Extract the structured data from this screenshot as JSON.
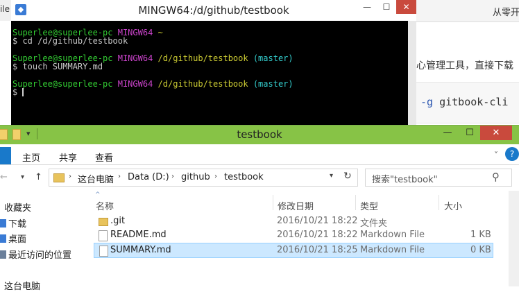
{
  "background_page": {
    "title": "从零开",
    "text_line": "心管理工具，直接下载",
    "code_prefix": "-g",
    "code_rest": " gitbook-cli"
  },
  "left_window": {
    "title": "ile"
  },
  "terminal": {
    "title": "MINGW64:/d/github/testbook",
    "controls": {
      "minimize": "—",
      "maximize": "☐",
      "close": "✕"
    },
    "icon": "mingw-terminal-icon",
    "user": "Superlee@superlee-pc",
    "env": "MINGW64",
    "lines": {
      "l1_path": "~",
      "l2": "$ cd /d/github/testbook",
      "l3_path": "/d/github/testbook",
      "l3_branch": "(master)",
      "l4": "$ touch SUMMARY.md",
      "l5_path": "/d/github/testbook",
      "l5_branch": "(master)",
      "l6": "$"
    },
    "colors": {
      "user": "#33cc33",
      "env": "#cc44cc",
      "path": "#cccc33",
      "branch": "#33cccc"
    }
  },
  "explorer": {
    "title": "testbook",
    "controls": {
      "minimize": "—",
      "maximize": "☐",
      "close": "✕"
    },
    "ribbon_tabs": [
      "主页",
      "共享",
      "查看"
    ],
    "nav": {
      "back": "←",
      "forward_dropdown": "▾",
      "up": "↑"
    },
    "breadcrumb": [
      "这台电脑",
      "Data (D:)",
      "github",
      "testbook"
    ],
    "search_placeholder": "搜索\"testbook\"",
    "columns": {
      "name": "名称",
      "modified": "修改日期",
      "type": "类型",
      "size": "大小"
    },
    "nav_pane": [
      "收藏夹",
      "下载",
      "桌面",
      "最近访问的位置",
      "这台电脑"
    ],
    "files": [
      {
        "name": ".git",
        "modified": "2016/10/21 18:22",
        "type": "文件夹",
        "size": "",
        "icon": "folder-icon"
      },
      {
        "name": "README.md",
        "modified": "2016/10/21 18:22",
        "type": "Markdown File",
        "size": "1 KB",
        "icon": "markdown-file-icon"
      },
      {
        "name": "SUMMARY.md",
        "modified": "2016/10/21 18:25",
        "type": "Markdown File",
        "size": "0 KB",
        "icon": "markdown-file-icon",
        "selected": true
      }
    ],
    "accent": "#87c346"
  }
}
